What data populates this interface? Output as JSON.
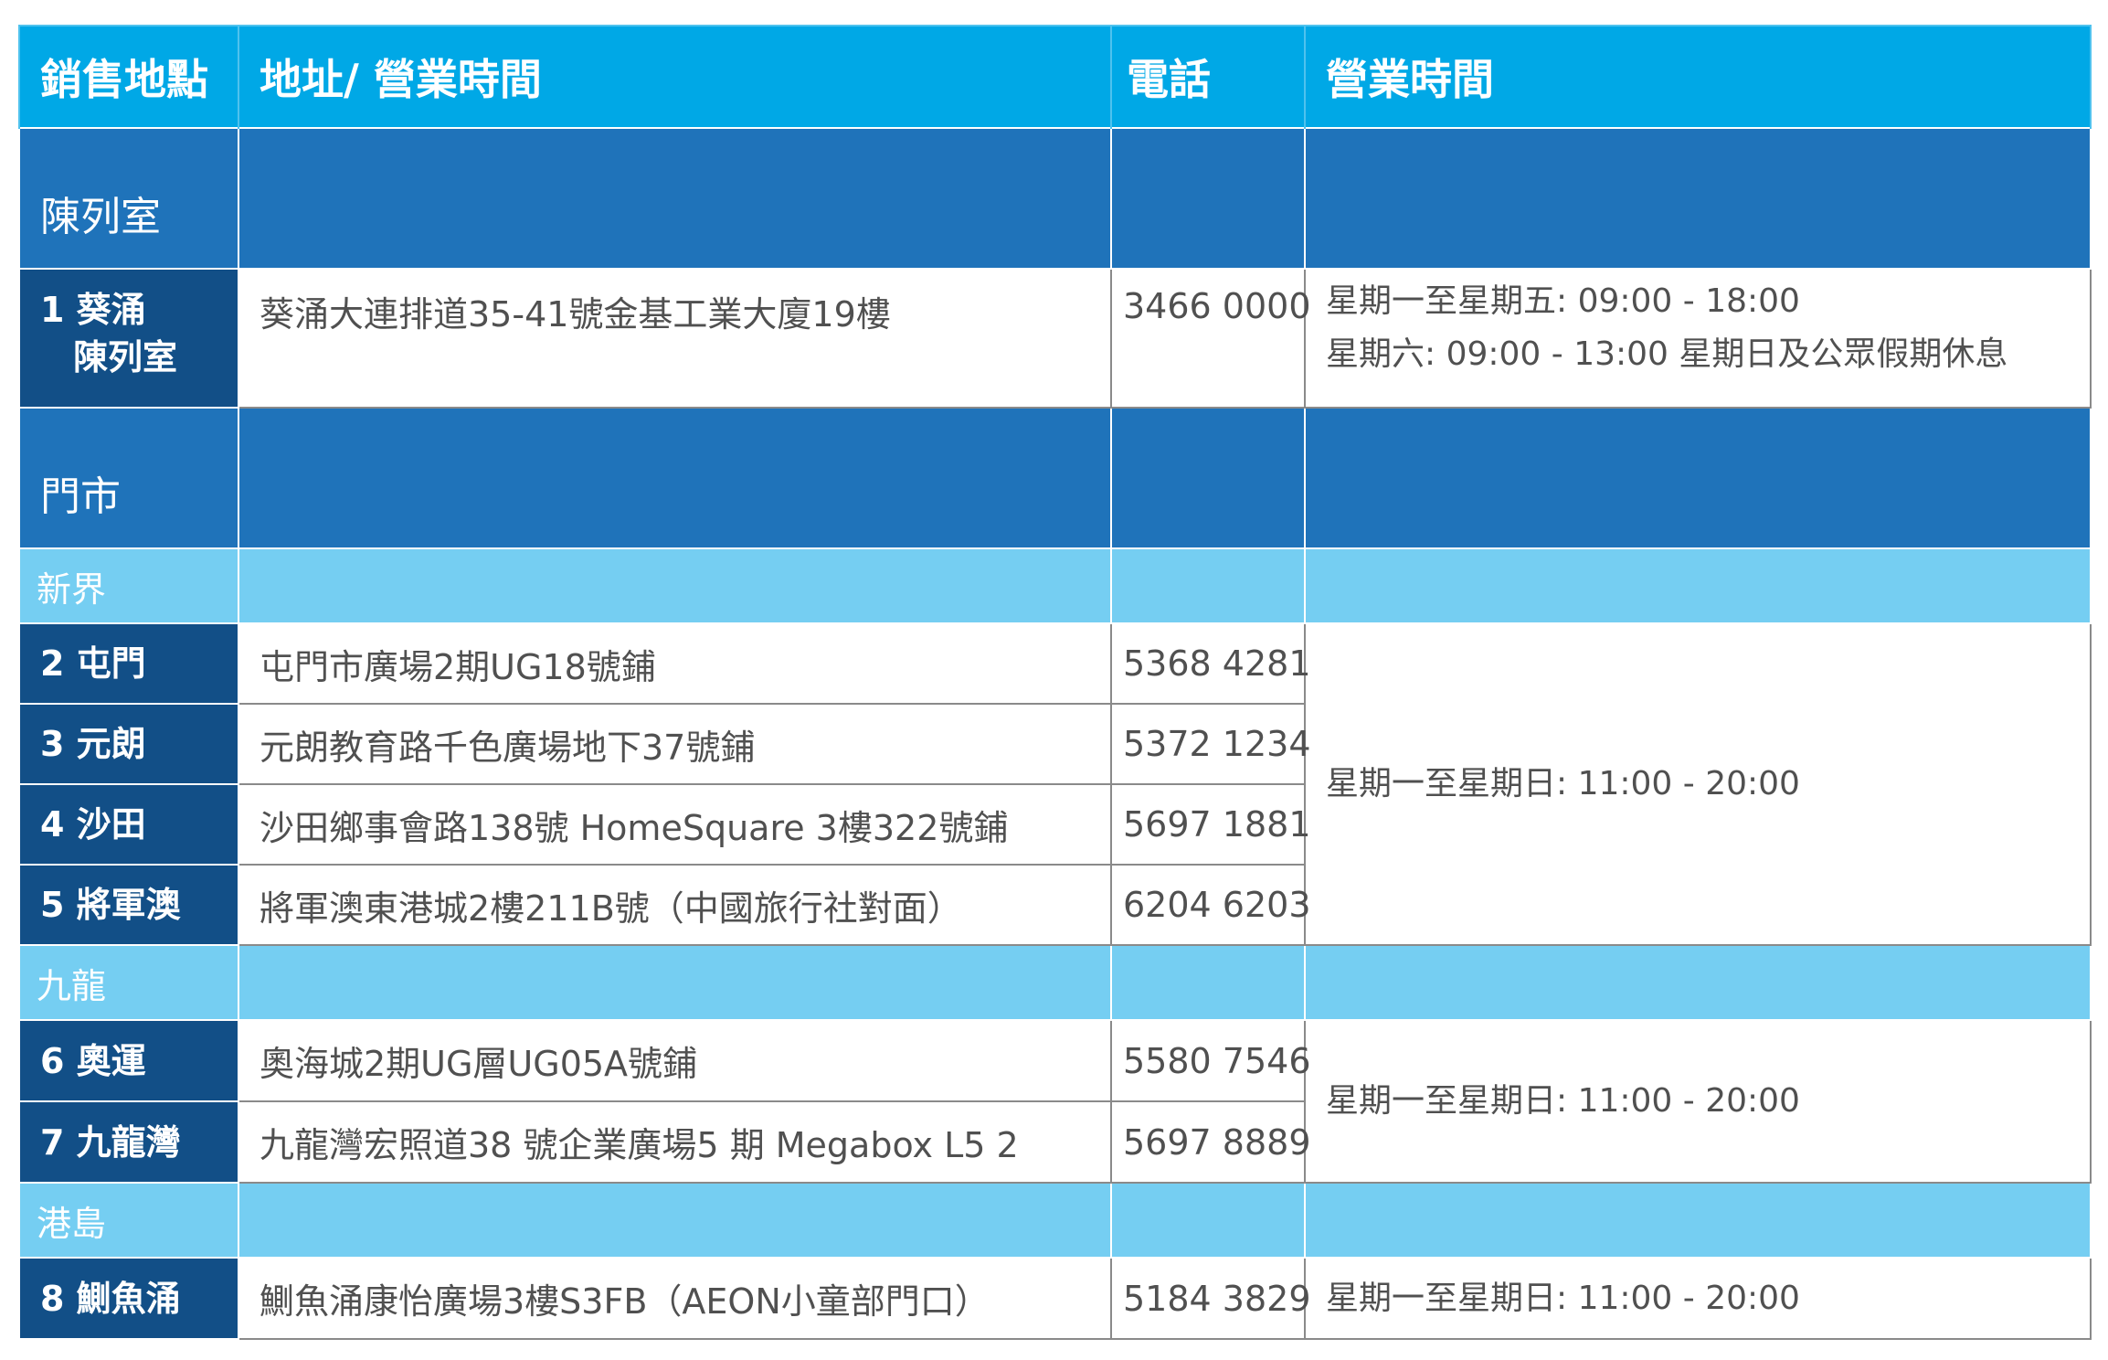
{
  "header": {
    "location": "銷售地點",
    "address": "地址/ 營業時間",
    "phone": "電話",
    "hours": "營業時間"
  },
  "sections": {
    "showroom": "陳列室",
    "stores": "門市",
    "nt": "新界",
    "kowloon": "九龍",
    "hk": "港島"
  },
  "rows": [
    {
      "loc_line1": "1 葵涌",
      "loc_line2": "陳列室",
      "address": "葵涌大連排道35-41號金基工業大廈19樓",
      "phone": "3466 0000",
      "hours_line1": "星期一至星期五: 09:00 - 18:00",
      "hours_line2": "星期六: 09:00 - 13:00 星期日及公眾假期休息"
    },
    {
      "loc": "2 屯門",
      "address": "屯門市廣場2期UG18號鋪",
      "phone": "5368 4281"
    },
    {
      "loc": "3 元朗",
      "address": "元朗教育路千色廣場地下37號鋪",
      "phone": "5372 1234"
    },
    {
      "loc": "4 沙田",
      "address": "沙田鄉事會路138號 HomeSquare 3樓322號鋪",
      "phone": "5697 1881"
    },
    {
      "loc": "5 將軍澳",
      "address": "將軍澳東港城2樓211B號（中國旅行社對面）",
      "phone": "6204 6203"
    },
    {
      "loc": "6 奧運",
      "address": "奧海城2期UG層UG05A號鋪",
      "phone": "5580 7546"
    },
    {
      "loc": "7 九龍灣",
      "address": "九龍灣宏照道38 號企業廣場5 期 Megabox L5 2",
      "phone": "5697 8889"
    },
    {
      "loc": "8 鰂魚涌",
      "address": "鰂魚涌康怡廣場3樓S3FB（AEON小童部門口）",
      "phone": "5184 3829"
    }
  ],
  "hours_groups": {
    "nt": "星期一至星期日: 11:00 - 20:00",
    "kowloon": "星期一至星期日: 11:00 - 20:00",
    "hk": "星期一至星期日: 11:00 - 20:00"
  },
  "colors": {
    "header_bg": "#00a8e6",
    "section_bg": "#1f73ba",
    "subsection_bg": "#75cef2",
    "location_bg": "#124f87"
  }
}
